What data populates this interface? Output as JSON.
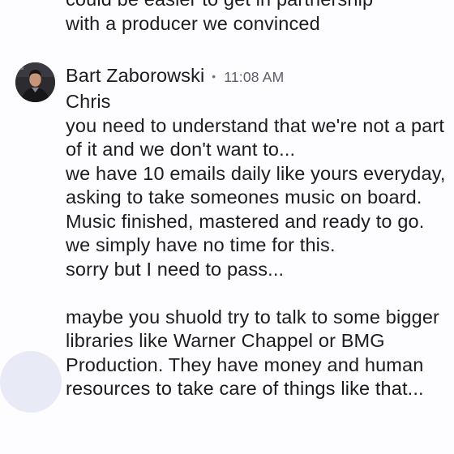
{
  "previous_message": {
    "text": "could be easier to get in partnership\nwith a producer we convinced"
  },
  "message": {
    "sender": "Bart Zaborowski",
    "separator": "•",
    "time": "11:08 AM",
    "avatar_icon": "user-avatar-photo",
    "body": "Chris\nyou need to understand that we're not a part of it and we don't want to...\nwe have 10 emails daily like yours everyday, asking to take someones music on board. Music finished, mastered and ready to go.\nwe simply have no time for this.\nsorry but I need to pass...\n\nmaybe you shuold try to talk to some bigger libraries like Warner Chappel or BMG Production. They have money and human resources to take care of things like that..."
  },
  "colors": {
    "background": "#fdfcff",
    "text": "#1b1b20",
    "timestamp": "#5c5d68",
    "floating_button": "#e5e9f5"
  }
}
